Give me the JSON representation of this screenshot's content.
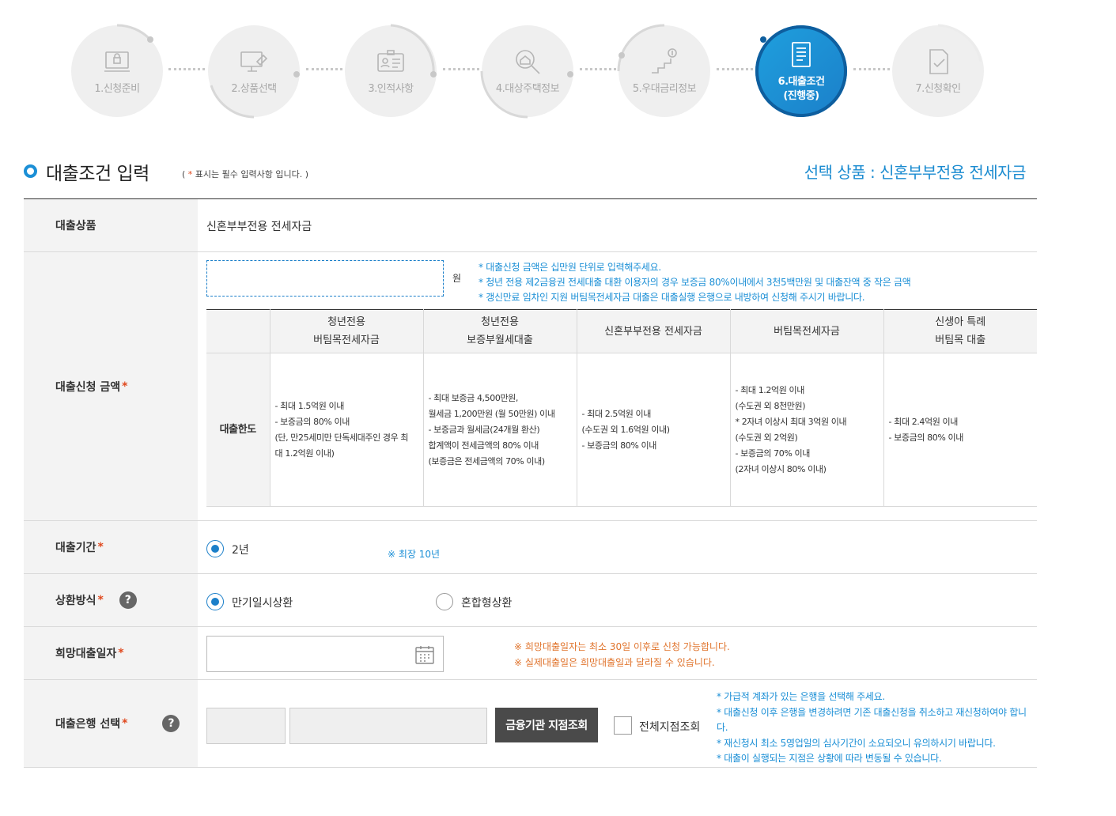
{
  "stepper": {
    "steps": [
      {
        "label": "1.신청준비",
        "icon": "computer-lock-icon"
      },
      {
        "label": "2.상품선택",
        "icon": "monitor-hand-icon"
      },
      {
        "label": "3.인적사항",
        "icon": "id-card-icon"
      },
      {
        "label": "4.대상주택정보",
        "icon": "house-search-icon"
      },
      {
        "label": "5.우대금리정보",
        "icon": "stairs-coin-icon"
      },
      {
        "label": "6.대출조건",
        "sub": "(진행중)",
        "icon": "document-list-icon",
        "active": true
      },
      {
        "label": "7.신청확인",
        "icon": "document-check-icon"
      }
    ]
  },
  "header": {
    "title": "대출조건 입력",
    "note_prefix": "( ",
    "note_star": "*",
    "note_text": " 표시는 필수 입력사항 입니다. )",
    "selected_product": "선택 상품 : 신혼부부전용 전세자금"
  },
  "form": {
    "product": {
      "label": "대출상품",
      "value": "신혼부부전용 전세자금"
    },
    "amount": {
      "label": "대출신청 금액",
      "unit": "원",
      "notes": [
        "* 대출신청 금액은 십만원 단위로 입력해주세요.",
        "* 청년 전용 제2금융권 전세대출 대환 이용자의 경우 보증금 80%이내에서 3천5백만원 및 대출잔액 중 작은 금액",
        "* 갱신만료 임차인 지원 버팀목전세자금 대출은 대출실행 은행으로 내방하여 신청해 주시기 바랍니다."
      ],
      "table": {
        "row_header": "대출한도",
        "columns": [
          {
            "line1": "청년전용",
            "line2": "버팀목전세자금"
          },
          {
            "line1": "청년전용",
            "line2": "보증부월세대출"
          },
          {
            "line1": "신혼부부전용 전세자금",
            "line2": ""
          },
          {
            "line1": "버팀목전세자금",
            "line2": ""
          },
          {
            "line1": "신생아 특례",
            "line2": "버팀목 대출"
          }
        ],
        "cells": [
          [
            "- 최대 1.5억원 이내",
            "- 보증금의 80% 이내",
            "(단, 만25세미만 단독세대주인 경우 최",
            "대 1.2억원 이내)"
          ],
          [
            "- 최대 보증금 4,500만원,",
            "월세금 1,200만원 (월 50만원) 이내",
            "- 보증금과 월세금(24개월 환산)",
            "합계액이 전세금액의 80% 이내",
            "(보증금은 전세금액의 70% 이내)"
          ],
          [
            "- 최대 2.5억원 이내",
            "(수도권 외 1.6억원 이내)",
            "- 보증금의 80% 이내"
          ],
          [
            "- 최대 1.2억원 이내",
            "(수도권 외 8천만원)",
            "* 2자녀 이상시 최대 3억원 이내",
            "(수도권 외 2억원)",
            "- 보증금의 70% 이내",
            "(2자녀 이상시 80% 이내)"
          ],
          [
            "- 최대 2.4억원 이내",
            "- 보증금의 80% 이내"
          ]
        ]
      }
    },
    "period": {
      "label": "대출기간",
      "option": "2년",
      "hint": "※ 최장 10년"
    },
    "repayment": {
      "label": "상환방식",
      "option1": "만기일시상환",
      "option2": "혼합형상환"
    },
    "date": {
      "label": "희망대출일자",
      "hints": [
        "※ 희망대출일자는 최소 30일 이후로 신청 가능합니다.",
        "※ 실제대출일은 희망대출일과 달라질 수 있습니다."
      ]
    },
    "bank": {
      "label": "대출은행 선택",
      "button": "금융기관 지점조회",
      "checkbox_label": "전체지점조회",
      "notes": [
        "* 가급적 계좌가 있는 은행을 선택해 주세요.",
        "* 대출신청 이후 은행을 변경하려면 기존 대출신청을 취소하고 재신청하여야 합니다.",
        "* 재신청시 최소 5영업일의 심사기간이 소요되오니 유의하시기 바랍니다.",
        "* 대출이 실행되는 지점은 상황에 따라 변동될 수 있습니다."
      ]
    },
    "required_mark": "*",
    "help_mark": "?"
  },
  "colors": {
    "accent": "#1b8fd6",
    "required": "#e0481d",
    "warning": "#e0742d",
    "button": "#4a4a4a"
  }
}
